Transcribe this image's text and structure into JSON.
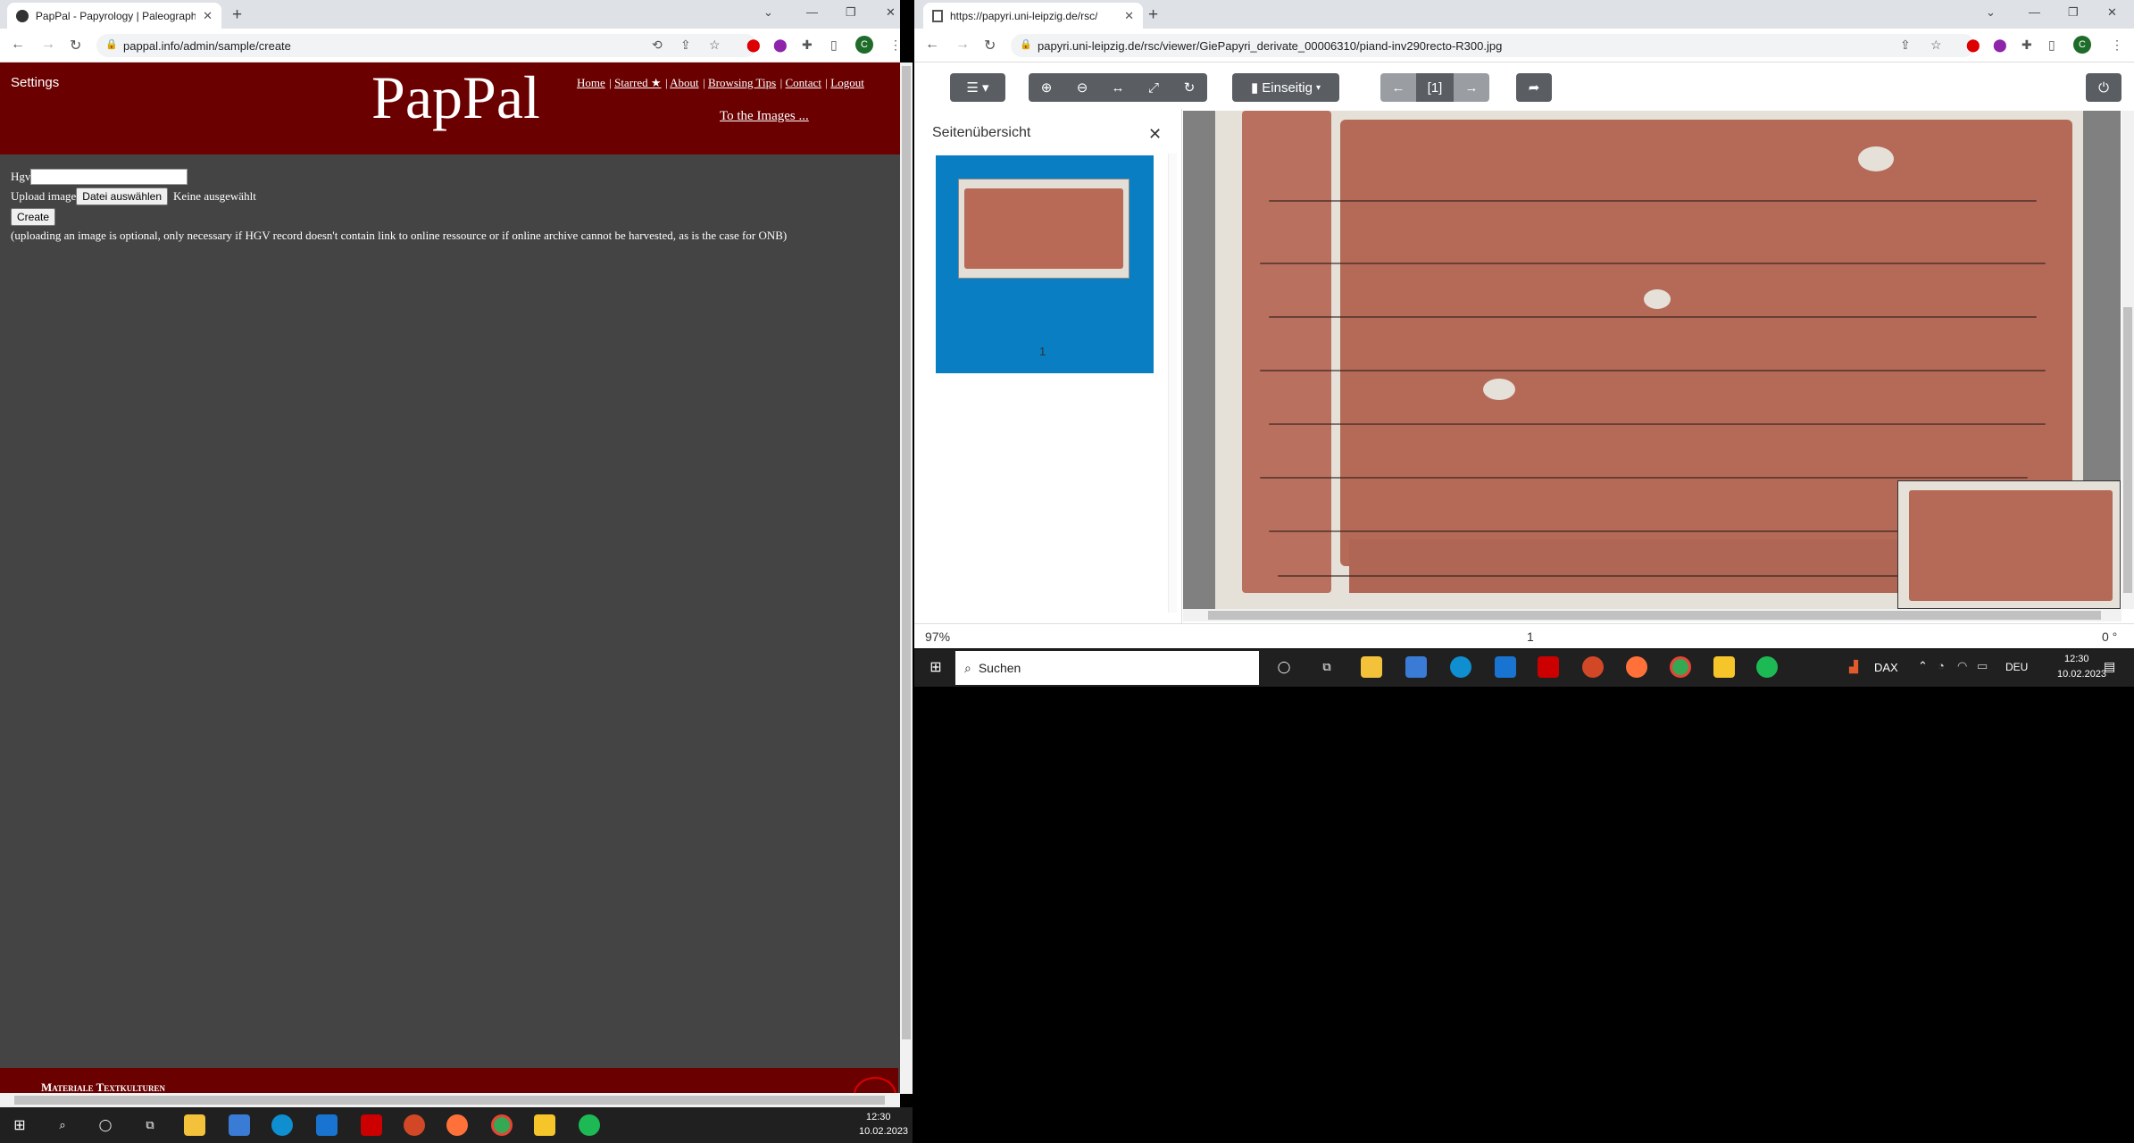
{
  "left_window": {
    "tab_title": "PapPal - Papyrology | Paleograph",
    "url": "pappal.info/admin/sample/create",
    "settings": "Settings",
    "logo": "PapPal",
    "nav": [
      "Home",
      "Starred ★",
      "About",
      "Browsing Tips",
      "Contact",
      "Logout"
    ],
    "to_images": "To the Images ...",
    "form": {
      "hgv_label": "Hgv",
      "hgv_value": "",
      "upload_label": "Upload image",
      "file_button": "Datei auswählen",
      "file_status": "Keine ausgewählt",
      "create_button": "Create",
      "note": "(uploading an image is optional, only necessary if HGV record doesn't contain link to online ressource or if online archive cannot be harvested, as is the case for ONB)"
    },
    "footer_text": "Materiale Textkulturen",
    "taskbar": {
      "time": "12:30",
      "date": "10.02.2023"
    }
  },
  "right_window": {
    "tab_title": "https://papyri.uni-leipzig.de/rsc/",
    "url": "papyri.uni-leipzig.de/rsc/viewer/GiePapyri_derivate_00006310/piand-inv290recto-R300.jpg",
    "viewer": {
      "mode_button": "Einseitig",
      "page_indicator": "[1]",
      "sidebar_title": "Seitenübersicht",
      "thumb_label": "1",
      "zoom": "97%",
      "status_page": "1",
      "rotation": "0 °"
    },
    "taskbar": {
      "search_placeholder": "Suchen",
      "dax": "DAX",
      "lang": "DEU",
      "time": "12:30",
      "date": "10.02.2023"
    }
  },
  "colors": {
    "pappal_red": "#6b0000",
    "page_gray": "#444444",
    "viewer_accent": "#0a7ec2"
  }
}
